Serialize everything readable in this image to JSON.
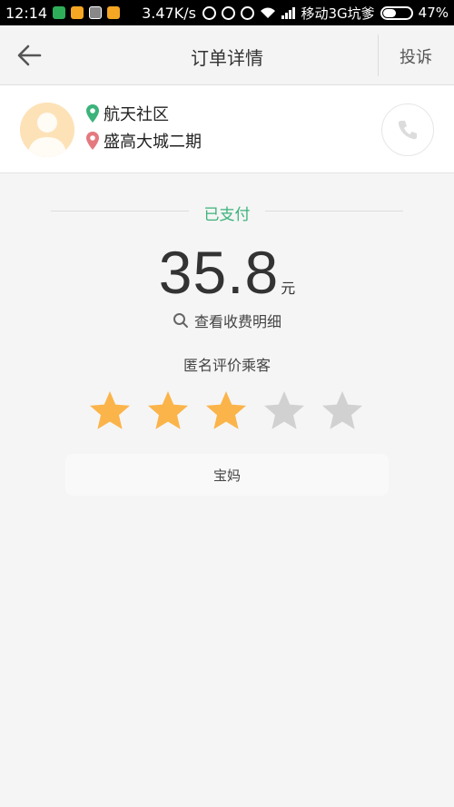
{
  "status_bar": {
    "time": "12:14",
    "speed": "3.47K/s",
    "carrier": "移动3G坑爹",
    "battery": "47%",
    "battery_level": 0.47
  },
  "header": {
    "title": "订单详情",
    "complain": "投诉",
    "back_icon": "arrow-left-icon"
  },
  "trip": {
    "start": "航天社区",
    "end": "盛高大城二期",
    "start_color": "#3bb37a",
    "end_color": "#e4797f",
    "call_icon": "phone-icon"
  },
  "payment": {
    "status": "已支付",
    "amount": "35.8",
    "unit": "元",
    "detail_link": "查看收费明细"
  },
  "rating": {
    "title": "匿名评价乘客",
    "value": 3,
    "max": 5,
    "filled_color": "#fbb44a",
    "empty_color": "#d1d1d1",
    "tag": "宝妈"
  }
}
